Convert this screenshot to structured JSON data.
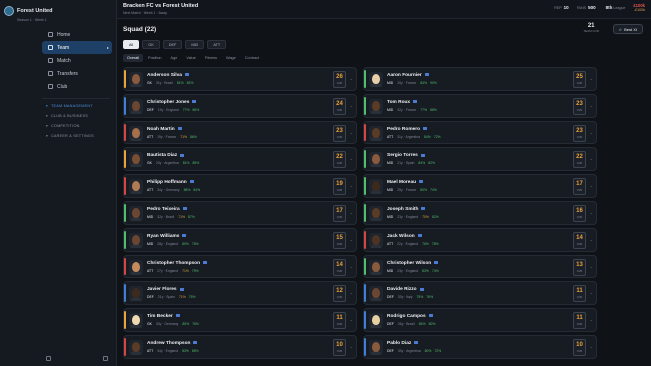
{
  "club": {
    "name": "Forest United",
    "subtitle": "Season 1 · Week 1"
  },
  "nav": [
    {
      "label": "Home",
      "icon": "home-icon",
      "active": false
    },
    {
      "label": "Team",
      "icon": "team-icon",
      "active": true
    },
    {
      "label": "Match",
      "icon": "match-icon",
      "active": false
    },
    {
      "label": "Transfers",
      "icon": "transfers-icon",
      "active": false
    },
    {
      "label": "Club",
      "icon": "club-icon",
      "active": false
    }
  ],
  "nav_groups": [
    {
      "label": "TEAM MANAGEMENT",
      "highlight": true
    },
    {
      "label": "CLUB & BUSINESS",
      "highlight": false
    },
    {
      "label": "COMPETITION",
      "highlight": false
    },
    {
      "label": "CAREER & SETTINGS",
      "highlight": false
    }
  ],
  "top": {
    "match_title": "Bracken FC vs Forest United",
    "match_sub": "Next Match · Week 1 · Away",
    "rep_label": "REP",
    "rep_value": "10",
    "fans_label": "FANS",
    "fans_value": "500",
    "league_value": "8th",
    "league_label": "League",
    "money_main": "£100k",
    "money_sub": "-£100k"
  },
  "squad": {
    "title": "Squad (22)",
    "count_num": "21",
    "count_label": "TEAM OVR",
    "best_label": "Best XI"
  },
  "filters": [
    {
      "label": "All",
      "active": true
    },
    {
      "label": "GK",
      "active": false
    },
    {
      "label": "DEF",
      "active": false
    },
    {
      "label": "MID",
      "active": false
    },
    {
      "label": "ATT",
      "active": false
    }
  ],
  "tabs": [
    {
      "label": "Overall",
      "active": true
    },
    {
      "label": "Position",
      "active": false
    },
    {
      "label": "Age",
      "active": false
    },
    {
      "label": "Value",
      "active": false
    },
    {
      "label": "Fitness",
      "active": false
    },
    {
      "label": "Wage",
      "active": false
    },
    {
      "label": "Contract",
      "active": false
    }
  ],
  "colors": {
    "GK": "#e8a33c",
    "DEF": "#3f7fd6",
    "MID": "#4fbf6b",
    "ATT": "#d94545",
    "accent": "#1e3f66"
  },
  "ovr_label": "OVR",
  "players": [
    {
      "name": "Anderson Silva",
      "pos": "GK",
      "age": "31y",
      "nation": "Brazil",
      "fit": "81%",
      "mor": "83%",
      "ovr": "26",
      "skin": "#8a5a3c"
    },
    {
      "name": "Aaron Fournier",
      "pos": "MID",
      "age": "25y",
      "nation": "France",
      "fit": "84%",
      "mor": "90%",
      "ovr": "25",
      "skin": "#e8cfa8"
    },
    {
      "name": "Christopher Jones",
      "pos": "DEF",
      "age": "19y",
      "nation": "England",
      "fit": "77%",
      "mor": "86%",
      "ovr": "24",
      "skin": "#6b4630"
    },
    {
      "name": "Tom Roux",
      "pos": "MID",
      "age": "32y",
      "nation": "France",
      "fit": "77%",
      "mor": "88%",
      "ovr": "23",
      "skin": "#5a3b26"
    },
    {
      "name": "Noah Martin",
      "pos": "ATT",
      "age": "19y",
      "nation": "France",
      "fit": "71%",
      "mor": "86%",
      "ovr": "23",
      "skin": "#a8704a"
    },
    {
      "name": "Pedro Romero",
      "pos": "ATT",
      "age": "31y",
      "nation": "Argentina",
      "fit": "84%",
      "mor": "72%",
      "ovr": "23",
      "skin": "#5a3b26"
    },
    {
      "name": "Bautista Diaz",
      "pos": "GK",
      "age": "20y",
      "nation": "Argentina",
      "fit": "81%",
      "mor": "85%",
      "ovr": "22",
      "skin": "#7a4e33"
    },
    {
      "name": "Sergio Torres",
      "pos": "MID",
      "age": "21y",
      "nation": "Spain",
      "fit": "84%",
      "mor": "82%",
      "ovr": "22",
      "skin": "#8a5a3c"
    },
    {
      "name": "Philipp Hoffmann",
      "pos": "ATT",
      "age": "34y",
      "nation": "Germany",
      "fit": "88%",
      "mor": "84%",
      "ovr": "19",
      "skin": "#b07a52"
    },
    {
      "name": "Mael Moreau",
      "pos": "MID",
      "age": "25y",
      "nation": "France",
      "fit": "80%",
      "mor": "74%",
      "ovr": "17",
      "skin": "#3e2a1c"
    },
    {
      "name": "Pedro Teixeira",
      "pos": "MID",
      "age": "32y",
      "nation": "Brazil",
      "fit": "71%",
      "mor": "87%",
      "ovr": "17",
      "skin": "#6b4630"
    },
    {
      "name": "Joseph Smith",
      "pos": "MID",
      "age": "23y",
      "nation": "England",
      "fit": "70%",
      "mor": "82%",
      "ovr": "16",
      "skin": "#5a3b26"
    },
    {
      "name": "Ryan Williams",
      "pos": "MID",
      "age": "28y",
      "nation": "England",
      "fit": "80%",
      "mor": "76%",
      "ovr": "15",
      "skin": "#6b4630"
    },
    {
      "name": "Jack Wilson",
      "pos": "ATT",
      "age": "22y",
      "nation": "England",
      "fit": "76%",
      "mor": "78%",
      "ovr": "14",
      "skin": "#4e3322"
    },
    {
      "name": "Christopher Thompson",
      "pos": "ATT",
      "age": "27y",
      "nation": "England",
      "fit": "71%",
      "mor": "79%",
      "ovr": "14",
      "skin": "#c48a5c"
    },
    {
      "name": "Christopher Wilson",
      "pos": "MID",
      "age": "23y",
      "nation": "England",
      "fit": "83%",
      "mor": "74%",
      "ovr": "13",
      "skin": "#8a5a3c"
    },
    {
      "name": "Javier Flores",
      "pos": "DEF",
      "age": "21y",
      "nation": "Spain",
      "fit": "71%",
      "mor": "75%",
      "ovr": "12",
      "skin": "#3e2a1c"
    },
    {
      "name": "Davide Rizzo",
      "pos": "DEF",
      "age": "33y",
      "nation": "Italy",
      "fit": "75%",
      "mor": "76%",
      "ovr": "11",
      "skin": "#6b4630"
    },
    {
      "name": "Tim Becker",
      "pos": "GK",
      "age": "30y",
      "nation": "Germany",
      "fit": "85%",
      "mor": "76%",
      "ovr": "11",
      "skin": "#f0d9b0"
    },
    {
      "name": "Rodrigo Campos",
      "pos": "DEF",
      "age": "26y",
      "nation": "Brazil",
      "fit": "84%",
      "mor": "80%",
      "ovr": "11",
      "skin": "#e6cfa0"
    },
    {
      "name": "Andrew Thompson",
      "pos": "ATT",
      "age": "34y",
      "nation": "England",
      "fit": "83%",
      "mor": "85%",
      "ovr": "10",
      "skin": "#5a3b26"
    },
    {
      "name": "Pablo Diaz",
      "pos": "DEF",
      "age": "33y",
      "nation": "Argentina",
      "fit": "80%",
      "mor": "72%",
      "ovr": "10",
      "skin": "#8a5a3c"
    }
  ]
}
